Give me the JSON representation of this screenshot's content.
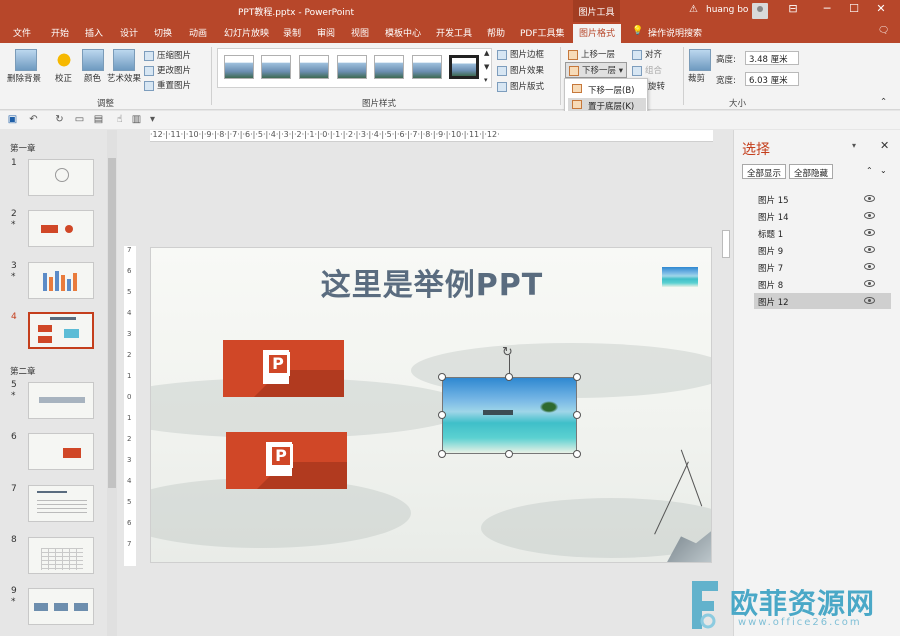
{
  "titlebar": {
    "doc_title": "PPT教程.pptx  -  PowerPoint",
    "context_tab": "图片工具",
    "user": "huang bo",
    "warn_icon": "warning-icon",
    "controls": [
      "⊟",
      "─",
      "☐",
      "✕"
    ]
  },
  "tabs": [
    "文件",
    "开始",
    "插入",
    "设计",
    "切换",
    "动画",
    "幻灯片放映",
    "录制",
    "审阅",
    "视图",
    "模板中心",
    "开发工具",
    "帮助",
    "PDF工具集",
    "图片格式"
  ],
  "tab_search": "操作说明搜索",
  "ribbon": {
    "remove_bg": "删除背景",
    "correct": "校正",
    "color": "颜色",
    "art_effects": "艺术效果",
    "compress": "压缩图片",
    "change_pic": "更改图片",
    "reset_pic": "重置图片",
    "group_adjust": "调整",
    "group_styles": "图片样式",
    "border": "图片边框",
    "effects": "图片效果",
    "layout": "图片版式",
    "bring_forward": "上移一层",
    "send_backward": "下移一层",
    "align": "对齐",
    "group": "组合",
    "rotate": "旋转",
    "crop": "裁剪",
    "height_label": "高度:",
    "height_value": "3.48 厘米",
    "width_label": "宽度:",
    "width_value": "6.03 厘米",
    "group_size": "大小"
  },
  "dropdown": {
    "item1": "下移一层(B)",
    "item2": "置于底层(K)"
  },
  "thumbnails": {
    "section1": "第一章",
    "section2": "第二章",
    "slides": [
      {
        "num": "1",
        "star": ""
      },
      {
        "num": "2",
        "star": "*"
      },
      {
        "num": "3",
        "star": "*"
      },
      {
        "num": "4",
        "star": ""
      },
      {
        "num": "5",
        "star": "*"
      },
      {
        "num": "6",
        "star": ""
      },
      {
        "num": "7",
        "star": ""
      },
      {
        "num": "8",
        "star": ""
      },
      {
        "num": "9",
        "star": "*"
      }
    ]
  },
  "ruler": {
    "h": "·12·|·11·|·10·|·9·|·8·|·7·|·6·|·5·|·4·|·3·|·2·|·1·|·0·|·1·|·2·|·3·|·4·|·5·|·6·|·7·|·8·|·9·|·10·|·11·|·12·",
    "v": [
      "7",
      "6",
      "5",
      "4",
      "3",
      "2",
      "1",
      "0",
      "1",
      "2",
      "3",
      "4",
      "5",
      "6",
      "7"
    ]
  },
  "slide": {
    "title": "这里是举例PPT"
  },
  "pane": {
    "title": "选择",
    "show_all": "全部显示",
    "hide_all": "全部隐藏",
    "items": [
      "图片 15",
      "图片 14",
      "标题 1",
      "图片 9",
      "图片 7",
      "图片 8",
      "图片 12"
    ],
    "selected_index": 6
  },
  "watermark": {
    "text": "欧菲资源网",
    "url": "www.office26.com"
  },
  "colors": {
    "brand": "#b7472a",
    "selection": "#c43e1c"
  }
}
